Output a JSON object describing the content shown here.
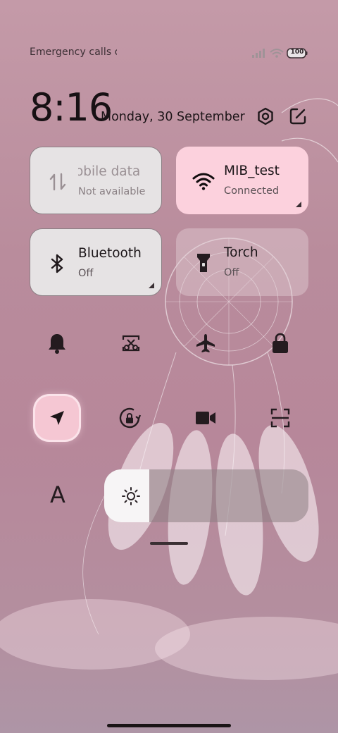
{
  "status": {
    "carrier_text": "Emergency calls o",
    "battery": "100"
  },
  "header": {
    "time": "8:16",
    "date": "Monday, 30 September",
    "settings_icon": "settings-hex-icon",
    "edit_icon": "edit-icon"
  },
  "tiles": [
    {
      "title": "Mobile data",
      "subtitle": "Not available",
      "icon": "mobile-data-icon",
      "state": "disabled"
    },
    {
      "title": "MIB_test",
      "subtitle": "Connected",
      "icon": "wifi-icon",
      "state": "on"
    },
    {
      "title": "Bluetooth",
      "subtitle": "Off",
      "icon": "bluetooth-icon",
      "state": "off"
    },
    {
      "title": "Torch",
      "subtitle": "Off",
      "icon": "torch-icon",
      "state": "off"
    }
  ],
  "quick_row1": [
    "bell-icon",
    "screenshot-icon",
    "airplane-icon",
    "lock-icon"
  ],
  "quick_row2": [
    "location-icon",
    "rotation-lock-icon",
    "video-icon",
    "scan-icon"
  ],
  "brightness": {
    "level": 0.22,
    "icon": "sun-icon"
  },
  "font_button_label": "A",
  "colors": {
    "accent_pink": "#fcd1dd",
    "tile_light": "#e6e3e4",
    "background": "#c49aa8"
  }
}
